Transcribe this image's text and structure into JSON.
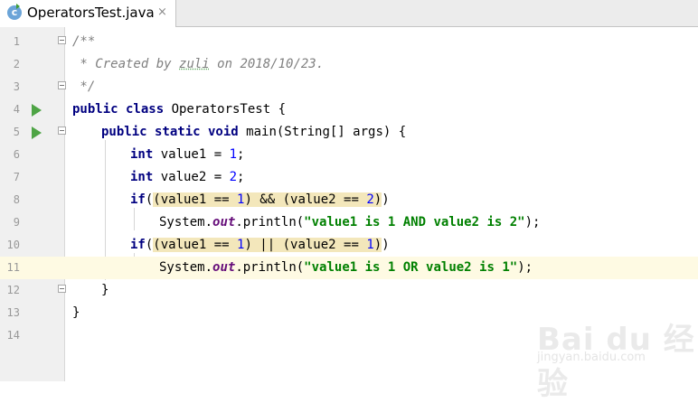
{
  "tab": {
    "title": "OperatorsTest.java",
    "icon": "java-class-icon",
    "close": "×"
  },
  "editor": {
    "lines": [
      {
        "n": "1"
      },
      {
        "n": "2"
      },
      {
        "n": "3"
      },
      {
        "n": "4"
      },
      {
        "n": "5"
      },
      {
        "n": "6"
      },
      {
        "n": "7"
      },
      {
        "n": "8"
      },
      {
        "n": "9"
      },
      {
        "n": "10"
      },
      {
        "n": "11"
      },
      {
        "n": "12"
      },
      {
        "n": "13"
      },
      {
        "n": "14"
      }
    ],
    "code": {
      "l1": "/**",
      "l2a": " * Created by ",
      "l2b": "zuli",
      "l2c": " on 2018/10/23.",
      "l3": " */",
      "l4a": "public class ",
      "l4b": "OperatorsTest {",
      "l5a": "public static void ",
      "l5b": "main(String[] args) {",
      "l6a": "int ",
      "l6b": "value1 = ",
      "l6c": "1",
      "l6d": ";",
      "l7a": "int ",
      "l7b": "value2 = ",
      "l7c": "2",
      "l7d": ";",
      "l8a": "if",
      "l8b": "(",
      "l8c": "(value1 == ",
      "l8d": "1",
      "l8e": ") && (value2 == ",
      "l8f": "2",
      "l8g": ")",
      "l8h": ")",
      "l9a": "System.",
      "l9b": "out",
      "l9c": ".println(",
      "l9d": "\"value1 is 1 AND value2 is 2\"",
      "l9e": ");",
      "l10a": "if",
      "l10b": "(",
      "l10c": "(value1 == ",
      "l10d": "1",
      "l10e": ") || (value2 == ",
      "l10f": "1",
      "l10g": ")",
      "l10h": ")",
      "l11a": "System.",
      "l11b": "out",
      "l11c": ".println(",
      "l11d": "\"value1 is 1 OR value2 is 1\"",
      "l11e": ");",
      "l12": "}",
      "l13": "}"
    }
  },
  "watermark": {
    "text": "Bai du 经验",
    "sub": "jingyan.baidu.com"
  },
  "colors": {
    "keyword": "#000080",
    "string": "#008000",
    "number": "#0000ff",
    "comment": "#808080",
    "static_field": "#660e7a",
    "highlight": "#f3e7bb",
    "current_line": "#fefae3",
    "run_marker": "#4ea445"
  }
}
